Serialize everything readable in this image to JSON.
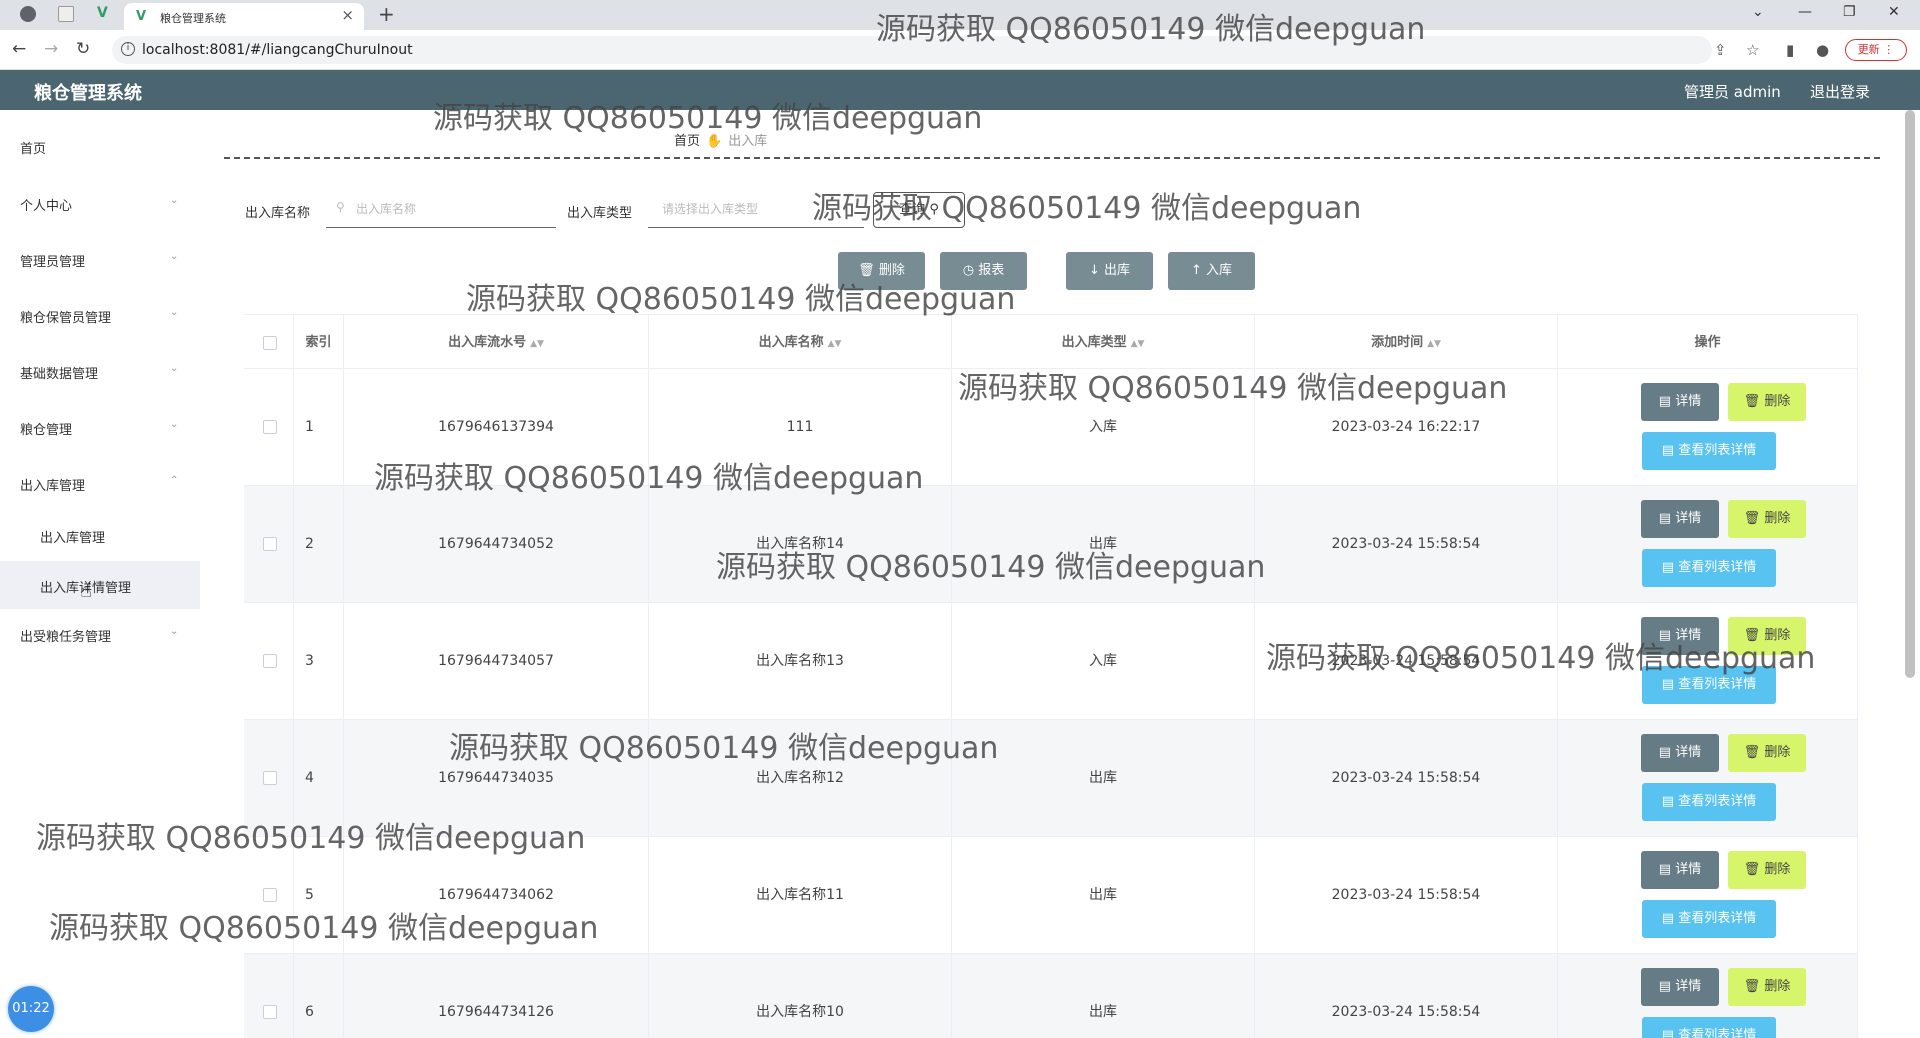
{
  "browser": {
    "tab_title": "粮仓管理系统",
    "url": "localhost:8081/#/liangcangChuruInout",
    "update_label": "更新"
  },
  "header": {
    "title": "粮仓管理系统",
    "user": "管理员 admin",
    "logout": "退出登录"
  },
  "sidebar": {
    "items": [
      {
        "label": "首页"
      },
      {
        "label": "个人中心"
      },
      {
        "label": "管理员管理"
      },
      {
        "label": "粮仓保管员管理"
      },
      {
        "label": "基础数据管理"
      },
      {
        "label": "粮仓管理"
      },
      {
        "label": "出入库管理"
      }
    ],
    "sub_items": [
      {
        "label": "出入库管理"
      },
      {
        "label": "出入库详情管理"
      }
    ],
    "last_item": {
      "label": "出受粮任务管理"
    }
  },
  "breadcrumb": {
    "home": "首页",
    "current": "出入库"
  },
  "filters": {
    "name_label": "出入库名称",
    "name_placeholder": "出入库名称",
    "type_label": "出入库类型",
    "type_placeholder": "请选择出入库类型",
    "query_label": "查询"
  },
  "actions": {
    "delete": "删除",
    "report": "报表",
    "out": "出库",
    "in": "入库"
  },
  "table": {
    "headers": {
      "index": "索引",
      "serial": "出入库流水号",
      "name": "出入库名称",
      "type": "出入库类型",
      "time": "添加时间",
      "ops": "操作"
    },
    "op_labels": {
      "detail": "详情",
      "delete": "删除",
      "list_detail": "查看列表详情"
    },
    "rows": [
      {
        "index": "1",
        "serial": "1679646137394",
        "name": "111",
        "type": "入库",
        "time": "2023-03-24 16:22:17"
      },
      {
        "index": "2",
        "serial": "1679644734052",
        "name": "出入库名称14",
        "type": "出库",
        "time": "2023-03-24 15:58:54"
      },
      {
        "index": "3",
        "serial": "1679644734057",
        "name": "出入库名称13",
        "type": "入库",
        "time": "2023-03-24 15:58:54"
      },
      {
        "index": "4",
        "serial": "1679644734035",
        "name": "出入库名称12",
        "type": "出库",
        "time": "2023-03-24 15:58:54"
      },
      {
        "index": "5",
        "serial": "1679644734062",
        "name": "出入库名称11",
        "type": "出库",
        "time": "2023-03-24 15:58:54"
      },
      {
        "index": "6",
        "serial": "1679644734126",
        "name": "出入库名称10",
        "type": "出库",
        "time": "2023-03-24 15:58:54"
      }
    ]
  },
  "timer": "01:22",
  "watermark": "源码获取 QQ86050149 微信deepguan"
}
